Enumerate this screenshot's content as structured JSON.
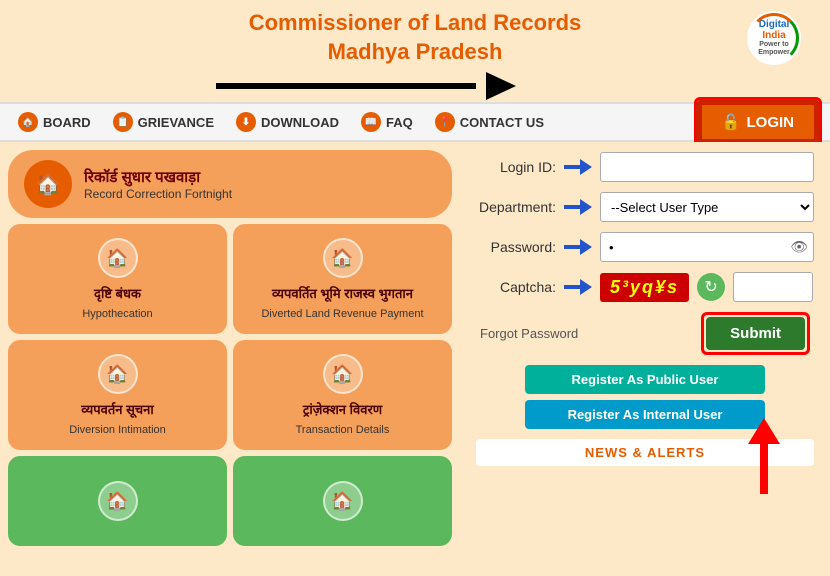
{
  "header": {
    "title_line1": "Commissioner of Land Records",
    "title_line2": "Madhya Pradesh",
    "digital_india_text": "Digital India",
    "digital_india_sub": "Power to Empower"
  },
  "navbar": {
    "items": [
      {
        "id": "board",
        "label": "BOARD",
        "icon": "🏠"
      },
      {
        "id": "grievance",
        "label": "GRIEVANCE",
        "icon": "📋"
      },
      {
        "id": "download",
        "label": "DOWNLOAD",
        "icon": "⬇"
      },
      {
        "id": "faq",
        "label": "FAQ",
        "icon": "📖"
      },
      {
        "id": "contact",
        "label": "CONTACT US",
        "icon": "📍"
      }
    ],
    "login_label": "LOGIN"
  },
  "banner": {
    "hindi": "रिकॉर्ड सुधार पखवाड़ा",
    "english": "Record Correction Fortnight"
  },
  "cards": [
    {
      "id": "hypothecation",
      "hindi": "दृष्टि बंधक",
      "english": "Hypothecation"
    },
    {
      "id": "diverted",
      "hindi": "व्यपवर्तित भूमि राजस्व भुगतान",
      "english": "Diverted Land Revenue Payment"
    },
    {
      "id": "diversion",
      "hindi": "व्यपवर्तन सूचना",
      "english": "Diversion Intimation"
    },
    {
      "id": "transaction",
      "hindi": "ट्रांज़ेक्शन विवरण",
      "english": "Transaction Details"
    }
  ],
  "login_form": {
    "login_id_label": "Login ID:",
    "department_label": "Department:",
    "department_placeholder": "--Select User Type",
    "password_label": "Password:",
    "captcha_label": "Captcha:",
    "captcha_text": "5³yq¥s",
    "forgot_label": "Forgot Password",
    "submit_label": "Submit",
    "register_public_label": "Register As Public User",
    "register_internal_label": "Register As Internal User",
    "news_alerts_label": "NEWS & ALERTS"
  }
}
